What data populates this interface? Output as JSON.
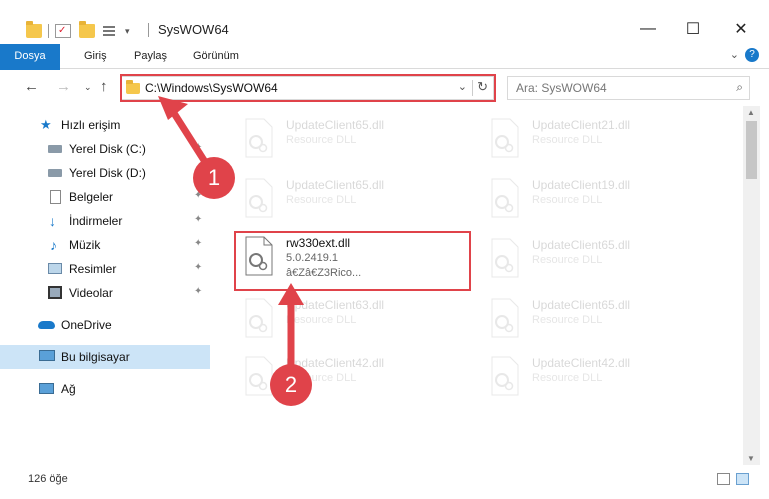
{
  "window": {
    "title": "SysWOW64",
    "controls": {
      "minimize": "—",
      "maximize": "☐",
      "close": "✕"
    }
  },
  "ribbon": {
    "tabs": [
      "Dosya",
      "Giriş",
      "Paylaş",
      "Görünüm"
    ],
    "help": "?"
  },
  "address": {
    "path": "C:\\Windows\\SysWOW64",
    "search_placeholder": "Ara: SysWOW64"
  },
  "sidebar": {
    "items": [
      {
        "label": "Hızlı erişim",
        "icon": "star-icon"
      },
      {
        "label": "Yerel Disk (C:)",
        "icon": "drive-icon"
      },
      {
        "label": "Yerel Disk (D:)",
        "icon": "drive-icon"
      },
      {
        "label": "Belgeler",
        "icon": "documents-icon"
      },
      {
        "label": "İndirmeler",
        "icon": "download-icon"
      },
      {
        "label": "Müzik",
        "icon": "music-icon"
      },
      {
        "label": "Resimler",
        "icon": "pictures-icon"
      },
      {
        "label": "Videolar",
        "icon": "videos-icon"
      },
      {
        "label": "OneDrive",
        "icon": "cloud-icon"
      },
      {
        "label": "Bu bilgisayar",
        "icon": "computer-icon"
      },
      {
        "label": "Ağ",
        "icon": "network-icon"
      }
    ]
  },
  "files": [
    {
      "name": "UpdateClient65.dll",
      "type": "Resource DLL"
    },
    {
      "name": "UpdateClient21.dll",
      "type": "Resource DLL"
    },
    {
      "name": "UpdateClient65.dll",
      "type": "Resource DLL"
    },
    {
      "name": "UpdateClient19.dll",
      "type": "Resource DLL"
    },
    {
      "name": "rw330ext.dll",
      "version": "5.0.2419.1",
      "description": "â€Zâ€Z3Rico..."
    },
    {
      "name": "UpdateClient65.dll",
      "type": "Resource DLL"
    },
    {
      "name": "UpdateClient63.dll",
      "type": "Resource DLL"
    },
    {
      "name": "UpdateClient65.dll",
      "type": "Resource DLL"
    },
    {
      "name": "UpdateClient42.dll",
      "type": "Resource DLL"
    },
    {
      "name": "UpdateClient42.dll",
      "type": "Resource DLL"
    }
  ],
  "status": {
    "count": "126 öğe"
  },
  "callouts": [
    "1",
    "2"
  ],
  "colors": {
    "accent": "#1979ca",
    "highlight": "#e0434a",
    "selected": "#cce4f7"
  }
}
